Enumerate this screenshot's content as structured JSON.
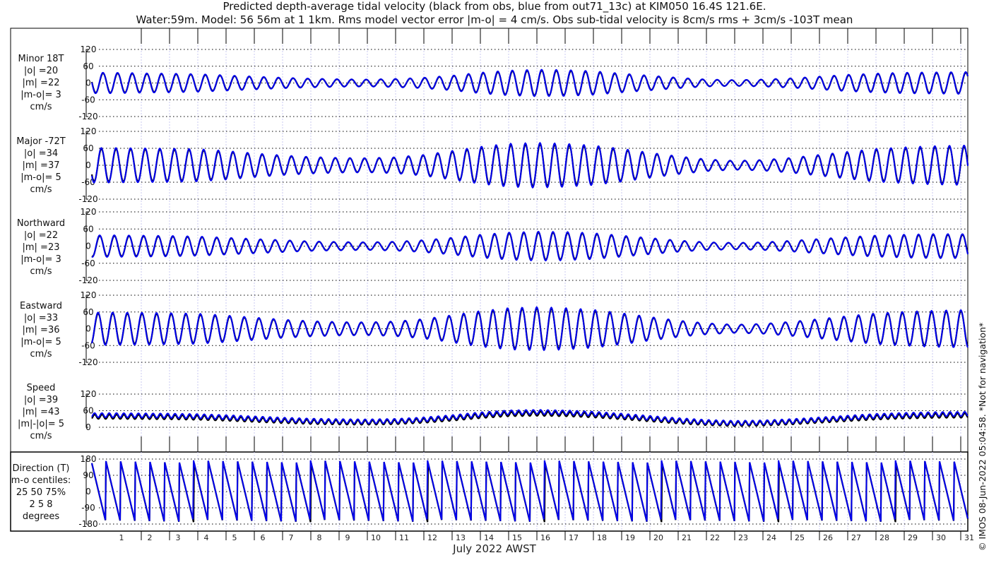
{
  "title_line1": "Predicted depth-average tidal velocity (black from obs, blue from out71_13c) at KIM050 16.4S 121.6E.",
  "title_line2": "Water:59m. Model: 56 56m at 1 1km. Rms model vector error |m-o| = 4 cm/s. Obs sub-tidal velocity is 8cm/s rms + 3cm/s -103T mean",
  "credit": "© IMOS 08-Jun-2022 05:04:58. *Not for navigation*",
  "colors": {
    "obs": "#000000",
    "model": "#0000ee",
    "grid": "#000000",
    "daygrid": "#c8c8f0"
  },
  "chart_data": {
    "type": "line",
    "xlabel": "July 2022 AWST",
    "x_ticks": [
      "1",
      "2",
      "3",
      "4",
      "5",
      "6",
      "7",
      "8",
      "9",
      "10",
      "11",
      "12",
      "13",
      "14",
      "15",
      "16",
      "17",
      "18",
      "19",
      "20",
      "21",
      "22",
      "23",
      "24",
      "25",
      "26",
      "27",
      "28",
      "29",
      "30",
      "31"
    ],
    "xlim_days": [
      0.25,
      31.25
    ],
    "tidal_period_hours": 12.42,
    "envelope_days": [
      0,
      1,
      2,
      3,
      4,
      5,
      6,
      7,
      8,
      9,
      10,
      11,
      12,
      13,
      14,
      15,
      16,
      17,
      18,
      19,
      20,
      21,
      22,
      23,
      24,
      25,
      26,
      27,
      28,
      29,
      30,
      31
    ],
    "panels": [
      {
        "name": "minor",
        "label": [
          "Minor 18T",
          "|o| =20",
          "|m| =22",
          "|m-o|= 3",
          "cm/s"
        ],
        "ylim": [
          -120,
          120
        ],
        "yticks": [
          "120",
          "60",
          "0",
          "-60",
          "-120"
        ],
        "tick_values": [
          120,
          60,
          0,
          -60,
          -120
        ],
        "envelope": [
          35,
          35,
          33,
          32,
          30,
          26,
          22,
          18,
          15,
          13,
          12,
          14,
          18,
          25,
          35,
          42,
          45,
          44,
          40,
          32,
          25,
          18,
          12,
          10,
          12,
          16,
          22,
          28,
          32,
          35,
          36,
          37
        ]
      },
      {
        "name": "major",
        "label": [
          "Major -72T",
          "|o| =34",
          "|m| =37",
          "|m-o|= 5",
          "cm/s"
        ],
        "ylim": [
          -120,
          120
        ],
        "yticks": [
          "120",
          "60",
          "0",
          "-60",
          "-120"
        ],
        "tick_values": [
          120,
          60,
          0,
          -60,
          -120
        ],
        "envelope": [
          58,
          58,
          57,
          56,
          54,
          48,
          40,
          33,
          28,
          25,
          24,
          27,
          35,
          48,
          62,
          72,
          75,
          72,
          66,
          55,
          42,
          30,
          20,
          15,
          18,
          25,
          35,
          45,
          55,
          60,
          64,
          66
        ]
      },
      {
        "name": "northward",
        "label": [
          "Northward",
          "|o| =22",
          "|m| =23",
          "|m-o|= 3",
          "cm/s"
        ],
        "ylim": [
          -120,
          120
        ],
        "yticks": [
          "120",
          "60",
          "0",
          "-60",
          "-120"
        ],
        "tick_values": [
          120,
          60,
          0,
          -60,
          -120
        ],
        "envelope": [
          36,
          36,
          35,
          34,
          32,
          28,
          24,
          20,
          16,
          14,
          13,
          15,
          20,
          28,
          38,
          45,
          48,
          47,
          43,
          35,
          27,
          19,
          13,
          11,
          13,
          18,
          24,
          30,
          35,
          38,
          40,
          40
        ]
      },
      {
        "name": "eastward",
        "label": [
          "Eastward",
          "|o| =33",
          "|m| =36",
          "|m-o|= 5",
          "cm/s"
        ],
        "ylim": [
          -120,
          120
        ],
        "yticks": [
          "120",
          "60",
          "0",
          "-60",
          "-120"
        ],
        "tick_values": [
          120,
          60,
          0,
          -60,
          -120
        ],
        "envelope": [
          55,
          55,
          54,
          53,
          51,
          45,
          38,
          31,
          26,
          23,
          22,
          25,
          33,
          46,
          60,
          70,
          73,
          70,
          64,
          53,
          40,
          28,
          19,
          14,
          17,
          24,
          33,
          43,
          52,
          57,
          61,
          63
        ]
      },
      {
        "name": "speed",
        "label": [
          "Speed",
          "|o| =39",
          "|m| =43",
          "|m|-|o|= 5",
          "cm/s"
        ],
        "ylim": [
          0,
          120
        ],
        "yticks": [
          "120",
          "60",
          "0"
        ],
        "tick_values": [
          120,
          60,
          0
        ],
        "envelope": [
          45,
          45,
          44,
          43,
          41,
          37,
          32,
          27,
          23,
          21,
          20,
          22,
          28,
          37,
          48,
          56,
          58,
          56,
          51,
          43,
          34,
          25,
          18,
          14,
          16,
          21,
          28,
          35,
          42,
          46,
          49,
          50
        ]
      },
      {
        "name": "direction",
        "label": [
          "Direction (T)",
          "m-o centiles:",
          "25  50  75%",
          "2  5  8",
          "degrees"
        ],
        "ylim": [
          -180,
          180
        ],
        "yticks": [
          "180",
          "90",
          "0",
          "-90",
          "-180"
        ],
        "tick_values": [
          180,
          90,
          0,
          -90,
          -180
        ]
      }
    ]
  }
}
